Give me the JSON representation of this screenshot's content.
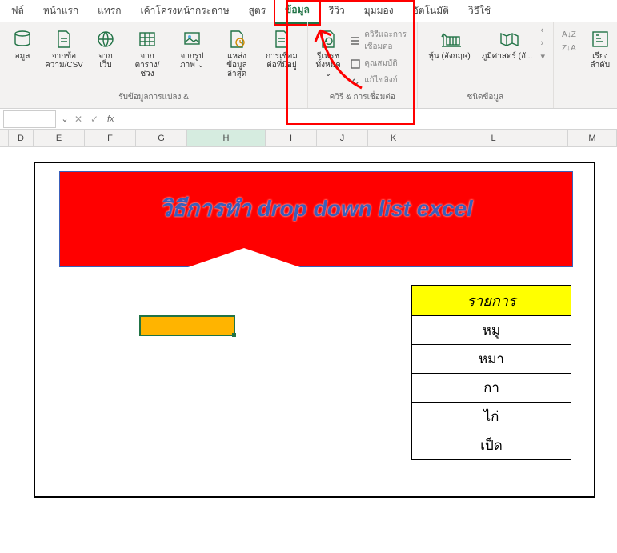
{
  "tabs": {
    "file": "ฟล์",
    "home": "หน้าแรก",
    "insert": "แทรก",
    "layout": "เค้าโครงหน้ากระดาษ",
    "formulas": "สูตร",
    "data": "ข้อมูล",
    "review": "รีวิว",
    "view": "มุมมอง",
    "automate": "อัตโนมัติ",
    "help": "วิธีใช้"
  },
  "ribbon": {
    "getdata": {
      "data": "อมูล",
      "textcsv": "จากข้อ\nความ/CSV",
      "web": "จาก\nเว็บ",
      "table": "จาก\nตาราง/ช่วง",
      "pic": "จากรูป\nภาพ ⌄",
      "recent": "แหล่ง\nข้อมูลล่าสุด",
      "conn": "การเชื่อม\nต่อที่มีอยู่",
      "label": "รับข้อมูลการแปลง &"
    },
    "queries": {
      "refresh": "รีเฟรช\nทั้งหมด ⌄",
      "links": "ควิรีและการเชื่อมต่อ",
      "props": "คุณสมบัติ",
      "edit": "แก้ไขลิงก์",
      "label": "ควิรี & การเชื่อมต่อ"
    },
    "datatypes": {
      "stocks": "หุ้น (อังกฤษ)",
      "geo": "ภูมิศาสตร์ (อั...",
      "label": "ชนิดข้อมูล"
    },
    "sort": {
      "az": "A↓Z",
      "za": "Z↓A",
      "sort": "เรียง\nลำดับ"
    }
  },
  "formula_bar": {
    "fx": "fx"
  },
  "columns": [
    "D",
    "E",
    "F",
    "G",
    "H",
    "I",
    "J",
    "K",
    "L",
    "M"
  ],
  "banner": "วิธีการทํา drop down list excel",
  "table": {
    "header": "รายการ",
    "rows": [
      "หมู",
      "หมา",
      "กา",
      "ไก่",
      "เป็ด"
    ]
  }
}
